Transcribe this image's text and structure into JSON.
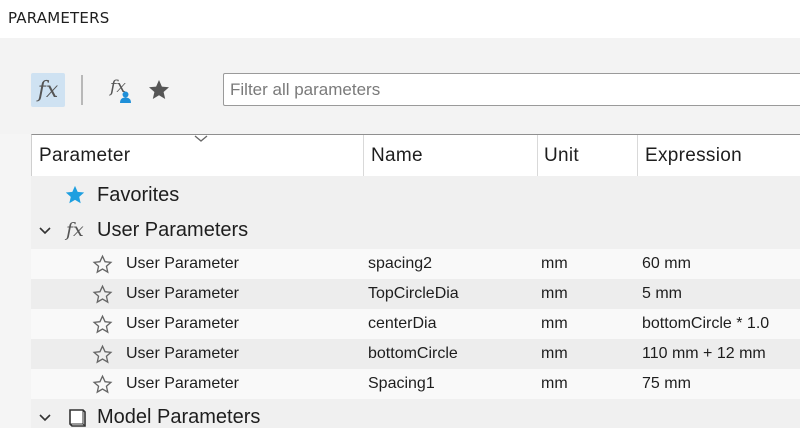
{
  "window": {
    "title": "PARAMETERS"
  },
  "toolbar": {
    "filter_placeholder": "Filter all parameters",
    "fx_label": "fx"
  },
  "table": {
    "columns": [
      "Parameter",
      "Name",
      "Unit",
      "Expression"
    ],
    "groups": {
      "favorites": {
        "label": "Favorites"
      },
      "user": {
        "label": "User Parameters",
        "expanded": true
      },
      "model": {
        "label": "Model Parameters",
        "expanded": true
      }
    },
    "rows": [
      {
        "parameter": "User Parameter",
        "name": "spacing2",
        "unit": "mm",
        "expression": "60 mm"
      },
      {
        "parameter": "User Parameter",
        "name": "TopCircleDia",
        "unit": "mm",
        "expression": "5 mm"
      },
      {
        "parameter": "User Parameter",
        "name": "centerDia",
        "unit": "mm",
        "expression": "bottomCircle * 1.0"
      },
      {
        "parameter": "User Parameter",
        "name": "bottomCircle",
        "unit": "mm",
        "expression": "110 mm + 12 mm"
      },
      {
        "parameter": "User Parameter",
        "name": "Spacing1",
        "unit": "mm",
        "expression": "75 mm"
      }
    ]
  },
  "colors": {
    "accent_star": "#1e9fe0",
    "active_button": "#cfe2f2",
    "user_icon": "#1e8fd8"
  }
}
